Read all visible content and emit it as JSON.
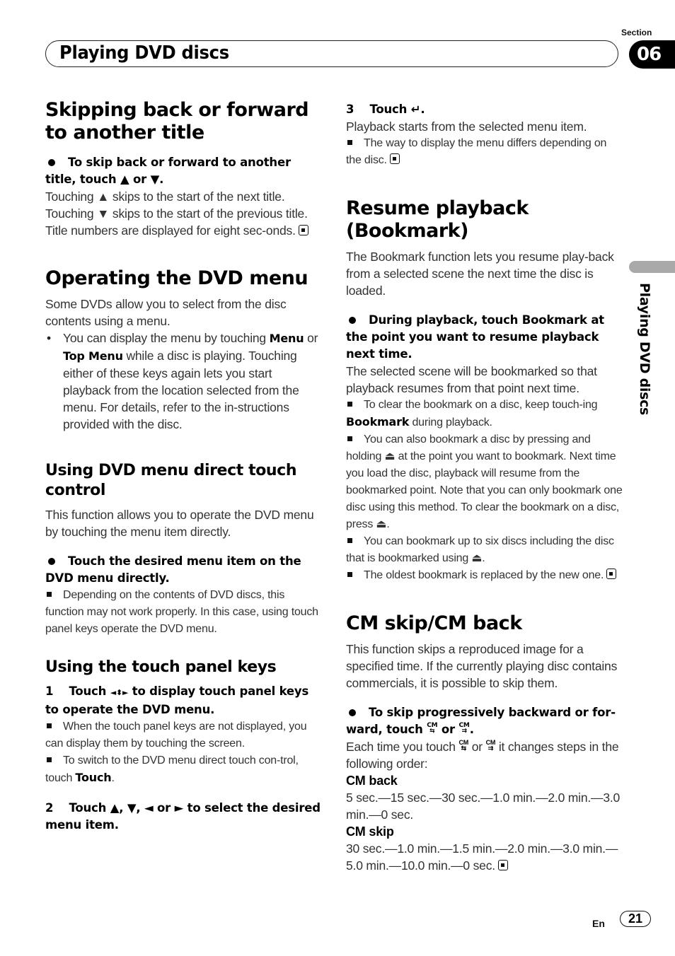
{
  "header": {
    "title": "Playing DVD discs",
    "section_label": "Section",
    "section_number": "06",
    "side_label": "Playing DVD discs"
  },
  "footer": {
    "language": "En",
    "page_number": "21"
  },
  "icons": {
    "up": "▲",
    "down": "▼",
    "left": "◄",
    "right": "►",
    "arrows_cross": "◄⬍►",
    "enter": "↵",
    "eject": "⏏",
    "cm_back": "CM back icon",
    "cm_skip": "CM skip icon",
    "end_mark": "end-of-section mark"
  },
  "left": {
    "skip": {
      "heading": "Skipping back or forward to another title",
      "instruction_a": "To skip back or forward to another title, touch",
      "instruction_or": "or",
      "line1_a": "Touching",
      "line1_b": "skips to the start of the next title.",
      "line2_a": "Touching",
      "line2_b": "skips to the start of the previous title.",
      "line3": "Title numbers are displayed for eight sec-onds."
    },
    "dvd_menu": {
      "heading": "Operating the DVD menu",
      "intro": "Some DVDs allow you to select from the disc contents using a menu.",
      "bullet_a": "You can display the menu by touching",
      "bullet_menu": "Menu",
      "bullet_or": "or",
      "bullet_top_menu": "Top Menu",
      "bullet_b": "while a disc is playing. Touching either of these keys again lets you start playback from the location selected from the menu. For details, refer to the in-structions provided with the disc."
    },
    "direct_touch": {
      "heading": "Using DVD menu direct touch control",
      "intro": "This function allows you to operate the DVD menu by touching the menu item directly.",
      "instruction": "Touch the desired menu item on the DVD menu directly.",
      "note": "Depending on the contents of DVD discs, this function may not work properly. In this case, using touch panel keys operate the DVD menu."
    },
    "panel_keys": {
      "heading": "Using the touch panel keys",
      "step1_num": "1",
      "step1_a": "Touch",
      "step1_b": "to display touch panel keys to operate the DVD menu.",
      "note1": "When the touch panel keys are not displayed, you can display them by touching the screen.",
      "note2_a": "To switch to the DVD menu direct touch con-trol, touch",
      "note2_key": "Touch",
      "step2_num": "2",
      "step2_a": "Touch",
      "step2_b": "to select the desired menu item.",
      "step2_or": "or"
    }
  },
  "right": {
    "step3": {
      "num": "3",
      "label": "Touch",
      "text": "Playback starts from the selected menu item.",
      "note": "The way to display the menu differs depending on the disc."
    },
    "bookmark": {
      "heading": "Resume playback (Bookmark)",
      "intro": "The Bookmark function lets you resume play-back from a selected scene the next time the disc is loaded.",
      "instruction": "During playback, touch Bookmark at the point you want to resume playback next time.",
      "text": "The selected scene will be bookmarked so that playback resumes from that point next time.",
      "note1_a": "To clear the bookmark on a disc, keep touch-ing",
      "note1_key": "Bookmark",
      "note1_b": "during playback.",
      "note2_a": "You can also bookmark a disc by pressing and holding",
      "note2_b": "at the point you want to bookmark. Next time you load the disc, playback will resume from the bookmarked point. Note that you can only bookmark one disc using this method. To clear the bookmark on a disc, press",
      "note3_a": "You can bookmark up to six discs including the disc that is bookmarked using",
      "note4": "The oldest bookmark is replaced by the new one."
    },
    "cm": {
      "heading": "CM skip/CM back",
      "intro": "This function skips a reproduced image for a specified time. If the currently playing disc contains commercials, it is possible to skip them.",
      "instruction_a": "To skip progressively backward or for-ward, touch",
      "instruction_or": "or",
      "text_a": "Each time you touch",
      "text_or": "or",
      "text_b": "it changes steps in the following order:",
      "back_label": "CM back",
      "back_steps": "5 sec.—15 sec.—30 sec.—1.0 min.—2.0 min.—3.0 min.—0 sec.",
      "skip_label": "CM skip",
      "skip_steps": "30 sec.—1.0 min.—1.5 min.—2.0 min.—3.0 min.—5.0 min.—10.0 min.—0 sec."
    }
  }
}
